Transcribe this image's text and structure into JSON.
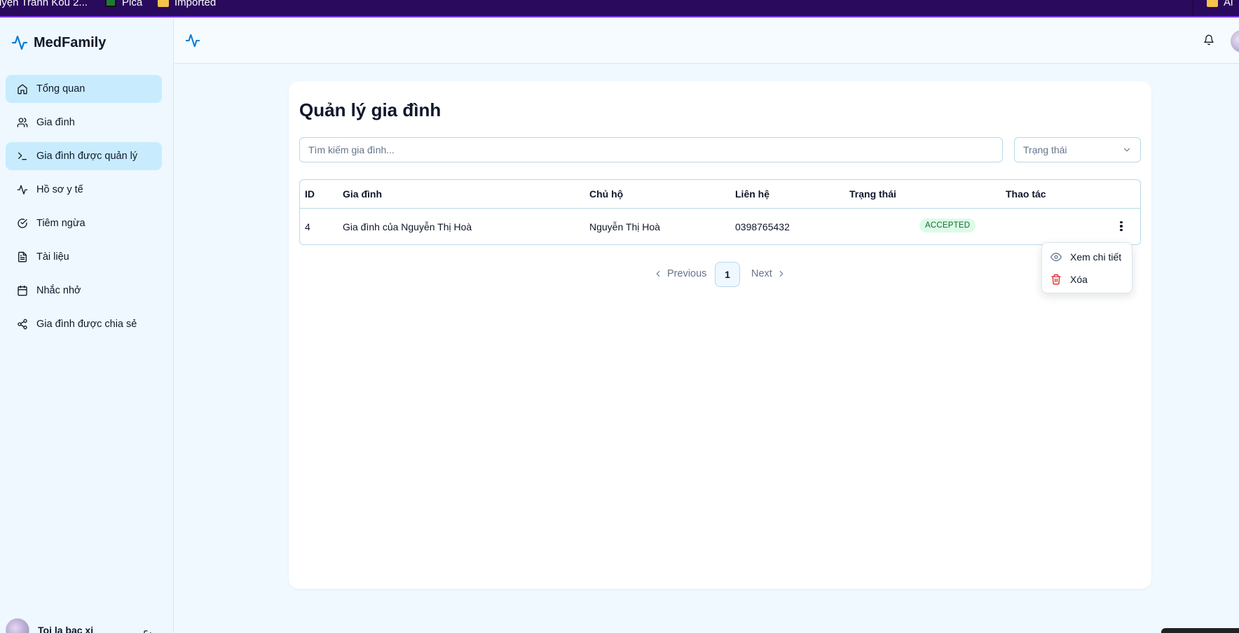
{
  "bookmarks": [
    {
      "label": "uyện Tranh Kou 2...",
      "icon": "none"
    },
    {
      "label": "Pica",
      "icon": "pica-icon"
    },
    {
      "label": "Imported",
      "icon": "folder-icon"
    },
    {
      "label": "Al",
      "icon": "folder-icon"
    }
  ],
  "sidebar": {
    "brand": "MedFamily",
    "items": [
      {
        "label": "Tổng quan",
        "icon": "home-icon",
        "active": true
      },
      {
        "label": "Gia đình",
        "icon": "users-icon",
        "active": false
      },
      {
        "label": "Gia đình được quản lý",
        "icon": "terminal-icon",
        "active": true
      },
      {
        "label": "Hồ sơ y tế",
        "icon": "activity-icon",
        "active": false
      },
      {
        "label": "Tiêm ngừa",
        "icon": "check-circle-icon",
        "active": false
      },
      {
        "label": "Tài liệu",
        "icon": "file-text-icon",
        "active": false
      },
      {
        "label": "Nhắc nhở",
        "icon": "calendar-icon",
        "active": false
      },
      {
        "label": "Gia đình được chia sẻ",
        "icon": "share-icon",
        "active": false
      }
    ],
    "user": {
      "name": "Toi la bac xi"
    }
  },
  "main": {
    "title": "Quản lý gia đình",
    "search": {
      "placeholder": "Tìm kiếm gia đình...",
      "value": ""
    },
    "status_filter": {
      "selected": "Trạng thái"
    },
    "table": {
      "columns": [
        "ID",
        "Gia đình",
        "Chủ hộ",
        "Liên hệ",
        "Trạng thái",
        "Thao tác"
      ],
      "rows": [
        {
          "id": "4",
          "family": "Gia đình của Nguyễn Thị Hoà",
          "head": "Nguyễn Thị Hoà",
          "contact": "0398765432",
          "status": "ACCEPTED"
        }
      ]
    },
    "pagination": {
      "previous": "Previous",
      "current": "1",
      "next": "Next"
    },
    "row_menu": {
      "items": [
        {
          "label": "Xem chi tiết",
          "icon": "eye-icon"
        },
        {
          "label": "Xóa",
          "icon": "trash-icon"
        }
      ]
    }
  },
  "colors": {
    "accent": "#0b7bd6",
    "active_nav": "#c8ecfd",
    "badge_bg": "#dcfce7",
    "badge_text": "#166534",
    "danger": "#dc2626",
    "bookmarks_bg": "#2a0a5c"
  }
}
